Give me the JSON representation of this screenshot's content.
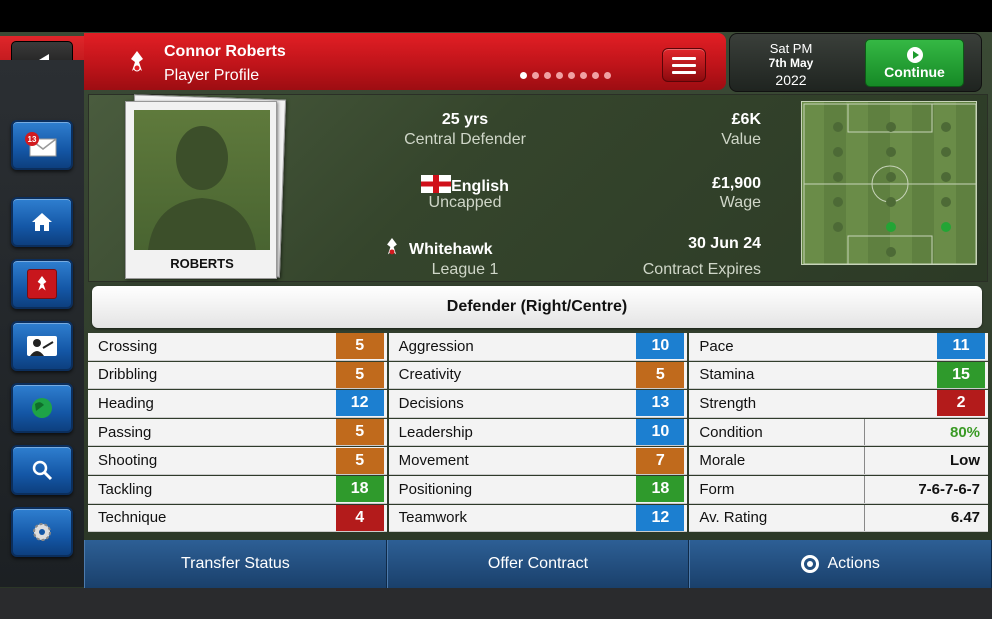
{
  "header": {
    "player_name": "Connor Roberts",
    "subtitle": "Player Profile",
    "page_dots": 8,
    "active_dot": 0
  },
  "date": {
    "line1": "Sat PM",
    "line2": "7th May",
    "line3": "2022"
  },
  "continue_label": "Continue",
  "profile": {
    "photo_name": "ROBERTS",
    "age": "25 yrs",
    "position": "Central Defender",
    "nationality": "English",
    "caps": "Uncapped",
    "club": "Whitehawk",
    "league": "League 1",
    "value": "£6K",
    "value_label": "Value",
    "wage": "£1,900",
    "wage_label": "Wage",
    "contract": "30 Jun 24",
    "contract_label": "Contract Expires"
  },
  "role": "Defender (Right/Centre)",
  "attributes": {
    "col1": [
      {
        "name": "Crossing",
        "value": "5",
        "color": "#c06a1c"
      },
      {
        "name": "Dribbling",
        "value": "5",
        "color": "#c06a1c"
      },
      {
        "name": "Heading",
        "value": "12",
        "color": "#1c7fd0"
      },
      {
        "name": "Passing",
        "value": "5",
        "color": "#c06a1c"
      },
      {
        "name": "Shooting",
        "value": "5",
        "color": "#c06a1c"
      },
      {
        "name": "Tackling",
        "value": "18",
        "color": "#2f9a2c"
      },
      {
        "name": "Technique",
        "value": "4",
        "color": "#b31b1b"
      }
    ],
    "col2": [
      {
        "name": "Aggression",
        "value": "10",
        "color": "#1c7fd0"
      },
      {
        "name": "Creativity",
        "value": "5",
        "color": "#c06a1c"
      },
      {
        "name": "Decisions",
        "value": "13",
        "color": "#1c7fd0"
      },
      {
        "name": "Leadership",
        "value": "10",
        "color": "#1c7fd0"
      },
      {
        "name": "Movement",
        "value": "7",
        "color": "#c06a1c"
      },
      {
        "name": "Positioning",
        "value": "18",
        "color": "#2f9a2c"
      },
      {
        "name": "Teamwork",
        "value": "12",
        "color": "#1c7fd0"
      }
    ],
    "col3": [
      {
        "name": "Pace",
        "value": "11",
        "color": "#1c7fd0"
      },
      {
        "name": "Stamina",
        "value": "15",
        "color": "#2f9a2c"
      },
      {
        "name": "Strength",
        "value": "2",
        "color": "#b31b1b"
      },
      {
        "name": "Condition",
        "value": "80%",
        "text_color": "#3a9a25"
      },
      {
        "name": "Morale",
        "value": "Low",
        "text_color": "#111111"
      },
      {
        "name": "Form",
        "value": "7-6-7-6-7",
        "text_color": "#111111"
      },
      {
        "name": "Av. Rating",
        "value": "6.47",
        "text_color": "#111111"
      }
    ]
  },
  "bottom": {
    "transfer_status": "Transfer Status",
    "offer_contract": "Offer Contract",
    "actions": "Actions"
  },
  "rail": {
    "mail_count": "13",
    "items": [
      "inbox-icon",
      "home-icon",
      "club-icon",
      "manager-icon",
      "globe-icon",
      "search-icon",
      "settings-icon"
    ]
  }
}
